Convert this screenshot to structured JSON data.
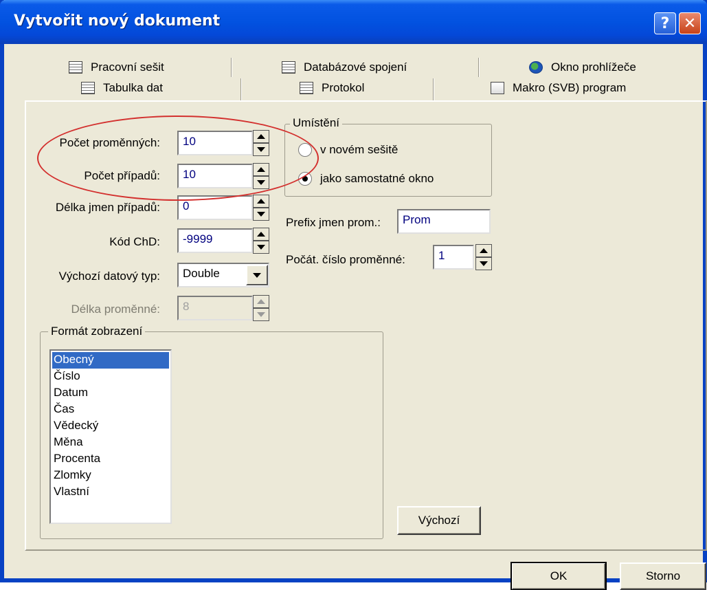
{
  "window": {
    "title": "Vytvořit nový dokument",
    "help_glyph": "?",
    "close_glyph": "✕"
  },
  "tabs_back": [
    {
      "label": "Pracovní sešit",
      "icon": "workbook-icon"
    },
    {
      "label": "Databázové spojení",
      "icon": "database-icon"
    },
    {
      "label": "Okno prohlížeče",
      "icon": "globe-icon"
    }
  ],
  "tabs_front": [
    {
      "label": "Tabulka dat",
      "icon": "data-table-icon",
      "active": true
    },
    {
      "label": "Protokol",
      "icon": "report-icon"
    },
    {
      "label": "Makro (SVB) program",
      "icon": "macro-icon"
    }
  ],
  "form": {
    "num_variables": {
      "label": "Počet proměnných:",
      "value": "10"
    },
    "num_cases": {
      "label": "Počet případů:",
      "value": "10"
    },
    "case_name_length": {
      "label": "Délka jmen případů:",
      "value": "0"
    },
    "md_code": {
      "label": "Kód ChD:",
      "value": "-9999"
    },
    "default_type": {
      "label": "Výchozí datový typ:",
      "value": "Double"
    },
    "variable_length": {
      "label": "Délka proměnné:",
      "value": "8"
    }
  },
  "placement": {
    "title": "Umístění",
    "options": [
      "v novém sešitě",
      "jako samostatné okno"
    ],
    "selected": "jako samostatné okno"
  },
  "prefix": {
    "label": "Prefix jmen prom.:",
    "value": "Prom"
  },
  "start_num": {
    "label": "Počát. číslo proměnné:",
    "value": "1"
  },
  "display_format": {
    "title": "Formát zobrazení",
    "items": [
      "Obecný",
      "Číslo",
      "Datum",
      "Čas",
      "Vědecký",
      "Měna",
      "Procenta",
      "Zlomky",
      "Vlastní"
    ],
    "selected": "Obecný"
  },
  "buttons": {
    "default": "Výchozí",
    "ok": "OK",
    "cancel": "Storno"
  }
}
